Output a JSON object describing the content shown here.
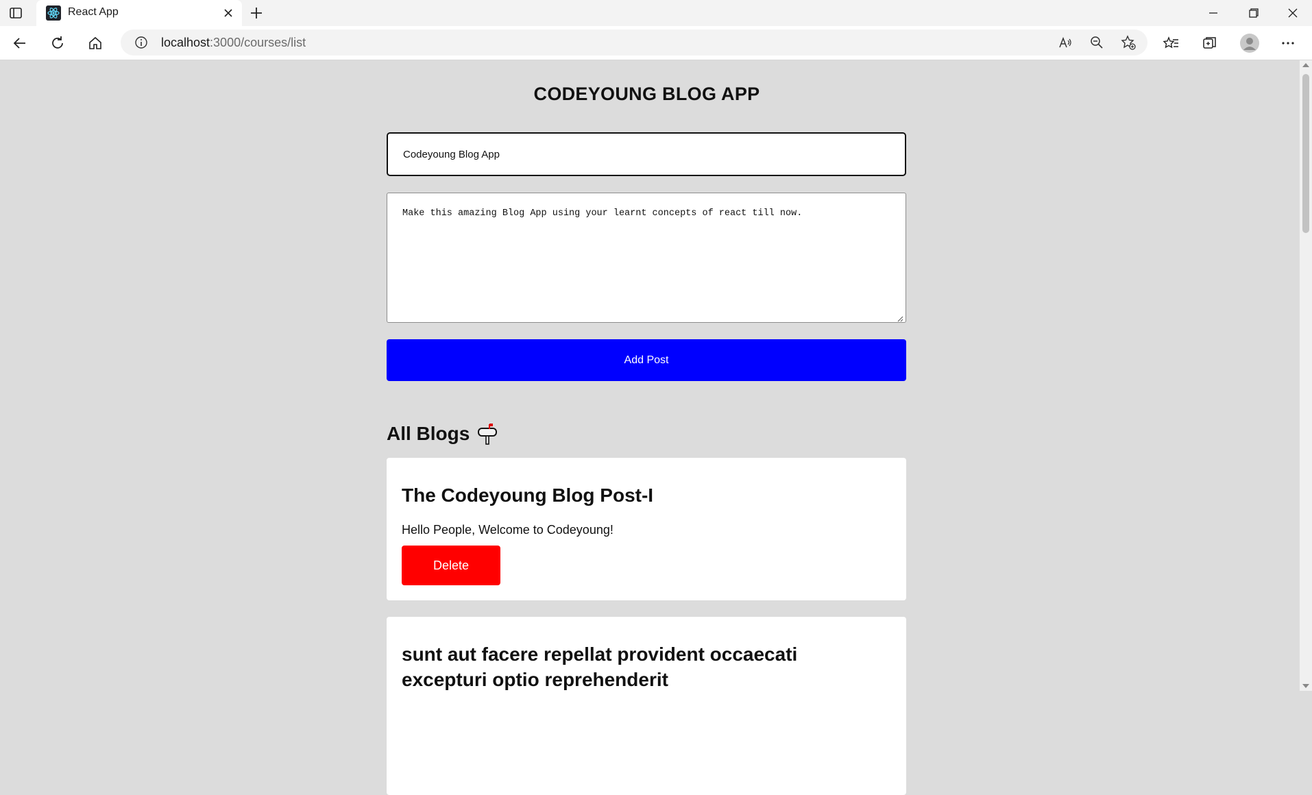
{
  "browser": {
    "tab_title": "React App",
    "url_host": "localhost",
    "url_path": ":3000/courses/list"
  },
  "app": {
    "title": "CODEYOUNG BLOG APP",
    "title_input_value": "Codeyoung Blog App",
    "description_value": "Make this amazing Blog App using your learnt concepts of react till now.",
    "add_post_label": "Add Post",
    "section_heading": "All Blogs"
  },
  "posts": [
    {
      "title": "The Codeyoung Blog Post-I",
      "body": "Hello People, Welcome to Codeyoung!",
      "delete_label": "Delete"
    },
    {
      "title": "sunt aut facere repellat provident occaecati excepturi optio reprehenderit"
    }
  ],
  "colors": {
    "page_bg": "#dcdcdc",
    "add_button": "#0000ff",
    "delete_button": "#ff0000",
    "card_bg": "#ffffff"
  },
  "icons": {
    "tab_actions": "tab-actions-icon",
    "favicon": "react-icon",
    "close": "close-icon",
    "new_tab": "plus-icon",
    "back": "back-arrow-icon",
    "refresh": "refresh-icon",
    "home": "home-icon",
    "info": "info-icon",
    "read_aloud": "read-aloud-icon",
    "zoom": "zoom-out-icon",
    "favorite": "add-favorite-icon",
    "favorites": "favorites-icon",
    "collections": "collections-icon",
    "profile": "profile-icon",
    "more": "more-icon",
    "mailbox": "mailbox-icon"
  }
}
